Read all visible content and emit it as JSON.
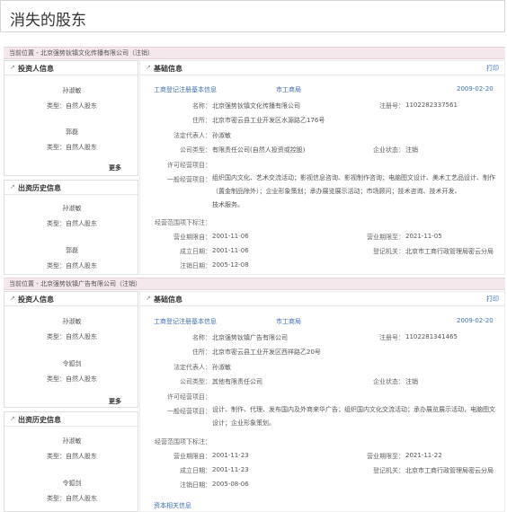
{
  "page_title": "消失的股东",
  "icons": {
    "section": "arrow-icon"
  },
  "colors": {
    "link": "#3f6fb6",
    "company_bar_bg": "#f4e8ec"
  },
  "sections": [
    {
      "location": "当前位置 - 北京强势钬镇文化传播有限公司（注销）",
      "investors_title": "投资人信息",
      "investors": [
        {
          "name": "孙淑敏",
          "type": "类型：自然人股东"
        },
        {
          "name": "郭磊",
          "type": "类型：自然人股东"
        }
      ],
      "more": "更多",
      "history_title": "出资历史信息",
      "history": [
        {
          "name": "孙淑敏",
          "type": "类型：自然人股东"
        },
        {
          "name": "郭磊",
          "type": "类型：自然人股东"
        }
      ],
      "basic_title": "基础信息",
      "print": "打印",
      "reg_link": "工商登记注册基本信息",
      "bureau_link": "市工商局",
      "date": "2009-02-20",
      "name_label": "名称：",
      "name_value": "北京强势钬镇文化传播有限公司",
      "regno_label": "注册号：",
      "regno_value": "1102282337561",
      "addr_label": "住所：",
      "addr_value": "北京市密云县工业开发区水源路乙176号",
      "rep_label": "法定代表人：",
      "rep_value": "孙淑敏",
      "ctype_label": "公司类型：",
      "ctype_value": "有限责任公司(自然人投资或控股)",
      "status_label": "企业状态：",
      "status_value": "注销",
      "permit_label": "许可经营项目：",
      "general_label": "一般经营项目：",
      "general_lines": [
        "组织国内文化、艺术交流活动；影视信息咨询、影视制作咨询；电脑图文设计、美术工艺品设计、制作",
        "（置金制品除外）；企业形象策划；承办展览展示活动；市场顾问；技术咨询、技术开发、",
        "技术服务。"
      ],
      "scope_note_label": "经营范围项下标注：",
      "from_label": "营业期限自：",
      "from_value": "2001-11-06",
      "to_label": "营业期限至：",
      "to_value": "2021-11-05",
      "est_label": "成立日期：",
      "est_value": "2001-11-06",
      "authority_label": "登记机关：",
      "authority_value": "北京市工商行政管理局密云分局",
      "cancel_label": "注销日期：",
      "cancel_value": "2005-12-08"
    },
    {
      "location": "当前位置 - 北京强势钬镇广告有限公司（注销）",
      "investors_title": "投资人信息",
      "investors": [
        {
          "name": "孙淑敏",
          "type": "类型：自然人股东"
        },
        {
          "name": "令狐剑",
          "type": "类型：自然人股东"
        }
      ],
      "more": "更多",
      "history_title": "出资历史信息",
      "history": [
        {
          "name": "孙淑敏",
          "type": "类型：自然人股东"
        },
        {
          "name": "令狐剑",
          "type": "类型：自然人股东"
        }
      ],
      "basic_title": "基础信息",
      "print": "打印",
      "reg_link": "工商登记注册基本信息",
      "bureau_link": "市工商局",
      "date": "2009-02-20",
      "name_label": "名称：",
      "name_value": "北京强势钬镇广告有限公司",
      "regno_label": "注册号：",
      "regno_value": "1102281341465",
      "addr_label": "住所：",
      "addr_value": "北京市密云县工业开发区西祥路乙20号",
      "rep_label": "法定代表人：",
      "rep_value": "孙淑敏",
      "ctype_label": "公司类型：",
      "ctype_value": "其他有限责任公司",
      "status_label": "企业状态：",
      "status_value": "注销",
      "permit_label": "许可经营项目：",
      "general_label": "一般经营项目：",
      "general_lines": [
        "设计、制作、代理、发布国内及外商来华广告；组织国内文化交流活动；承办展览展示活动，电脑图文",
        "设计；企业形象策划。"
      ],
      "scope_note_label": "经营范围项下标注：",
      "from_label": "营业期限自：",
      "from_value": "2001-11-23",
      "to_label": "营业期限至：",
      "to_value": "2021-11-22",
      "est_label": "成立日期：",
      "est_value": "2001-11-23",
      "authority_label": "登记机关：",
      "authority_value": "北京市工商行政管理局密云分局",
      "cancel_label": "注销日期：",
      "cancel_value": "2005-08-06",
      "capital_link": "资本相关信息"
    }
  ]
}
